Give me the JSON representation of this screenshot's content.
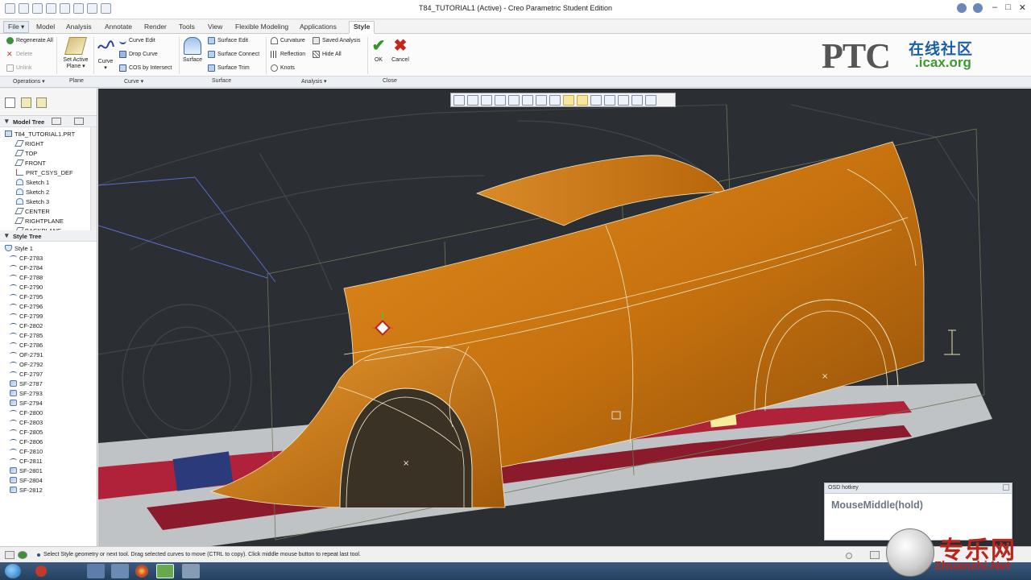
{
  "window": {
    "title": "T84_TUTORIAL1 (Active) - Creo Parametric Student Edition"
  },
  "tabs": [
    {
      "label": "File ▾"
    },
    {
      "label": "Model"
    },
    {
      "label": "Analysis"
    },
    {
      "label": "Annotate"
    },
    {
      "label": "Render"
    },
    {
      "label": "Tools"
    },
    {
      "label": "View"
    },
    {
      "label": "Flexible Modeling"
    },
    {
      "label": "Applications"
    },
    {
      "label": "Style"
    }
  ],
  "ribbon": {
    "operations": {
      "regenerate": "Regenerate All",
      "delete": "Delete",
      "unlink": "Unlink",
      "group": "Operations ▾"
    },
    "plane": {
      "set_active": "Set Active",
      "plane": "Plane ▾",
      "group": "Plane"
    },
    "curve": {
      "curve": "Curve",
      "curve_edit": "Curve Edit",
      "drop_curve": "Drop Curve",
      "cos": "COS by Intersect",
      "group": "Curve ▾"
    },
    "surface": {
      "surface": "Surface",
      "surface_edit": "Surface Edit",
      "surface_connect": "Surface Connect",
      "surface_trim": "Surface Trim",
      "group": "Surface"
    },
    "analysis": {
      "curvature": "Curvature",
      "reflection": "Reflection",
      "knots": "Knots",
      "saved_analysis": "Saved Analysis",
      "hide_all": "Hide All",
      "group": "Analysis ▾"
    },
    "close": {
      "ok": "OK",
      "cancel": "Cancel",
      "group": "Close"
    }
  },
  "logo": {
    "ptc": "PTC",
    "cn": "在线社区",
    "url": ".icax.org"
  },
  "model_tree": {
    "title": "Model Tree",
    "items": [
      {
        "label": "T84_TUTORIAL1.PRT",
        "icon": "part-icon"
      },
      {
        "label": "RIGHT",
        "icon": "datum-plane-icon"
      },
      {
        "label": "TOP",
        "icon": "datum-plane-icon"
      },
      {
        "label": "FRONT",
        "icon": "datum-plane-icon"
      },
      {
        "label": "PRT_CSYS_DEF",
        "icon": "csys-icon"
      },
      {
        "label": "Sketch 1",
        "icon": "sketch-icon"
      },
      {
        "label": "Sketch 2",
        "icon": "sketch-icon"
      },
      {
        "label": "Sketch 3",
        "icon": "sketch-icon"
      },
      {
        "label": "CENTER",
        "icon": "datum-plane-icon"
      },
      {
        "label": "RIGHTPLANE",
        "icon": "datum-plane-icon"
      },
      {
        "label": "BACKPLANE",
        "icon": "datum-plane-icon"
      }
    ]
  },
  "style_tree": {
    "title": "Style Tree",
    "root": "Style 1",
    "items": [
      {
        "label": "CF-2783",
        "icon": "curve-icon"
      },
      {
        "label": "CF-2784",
        "icon": "curve-icon"
      },
      {
        "label": "CF-2788",
        "icon": "curve-icon"
      },
      {
        "label": "CF-2790",
        "icon": "curve-icon"
      },
      {
        "label": "CF-2795",
        "icon": "curve-icon"
      },
      {
        "label": "CF-2796",
        "icon": "curve-icon"
      },
      {
        "label": "CF-2799",
        "icon": "curve-icon"
      },
      {
        "label": "CF-2802",
        "icon": "curve-icon"
      },
      {
        "label": "CF-2785",
        "icon": "curve-icon"
      },
      {
        "label": "CF-2786",
        "icon": "curve-icon"
      },
      {
        "label": "OF-2791",
        "icon": "curve-icon"
      },
      {
        "label": "OF-2792",
        "icon": "curve-icon"
      },
      {
        "label": "CF-2797",
        "icon": "curve-icon"
      },
      {
        "label": "SF-2787",
        "icon": "surface-icon"
      },
      {
        "label": "SF-2793",
        "icon": "surface-icon"
      },
      {
        "label": "SF-2794",
        "icon": "surface-icon"
      },
      {
        "label": "CF-2800",
        "icon": "curve-icon"
      },
      {
        "label": "CF-2803",
        "icon": "curve-icon"
      },
      {
        "label": "CF-2805",
        "icon": "curve-icon"
      },
      {
        "label": "CF-2806",
        "icon": "curve-icon"
      },
      {
        "label": "CF-2810",
        "icon": "curve-icon"
      },
      {
        "label": "CF-2811",
        "icon": "curve-icon"
      },
      {
        "label": "SF-2801",
        "icon": "surface-icon"
      },
      {
        "label": "SF-2804",
        "icon": "surface-icon"
      },
      {
        "label": "SF-2812",
        "icon": "surface-icon"
      }
    ]
  },
  "osd": {
    "title": "OSD hotkey",
    "content": "MouseMiddle(hold)"
  },
  "status": {
    "message": "Select Style geometry or next tool. Drag selected curves to move (CTRL to copy). Click middle mouse button to repeat last tool."
  },
  "watermark": {
    "cn": "专乐网",
    "net": "Zhuanzhi.Net"
  },
  "colors": {
    "surface": "#d07a16",
    "viewport_bg": "#2b2f33",
    "accent": "#1a5fa8"
  }
}
